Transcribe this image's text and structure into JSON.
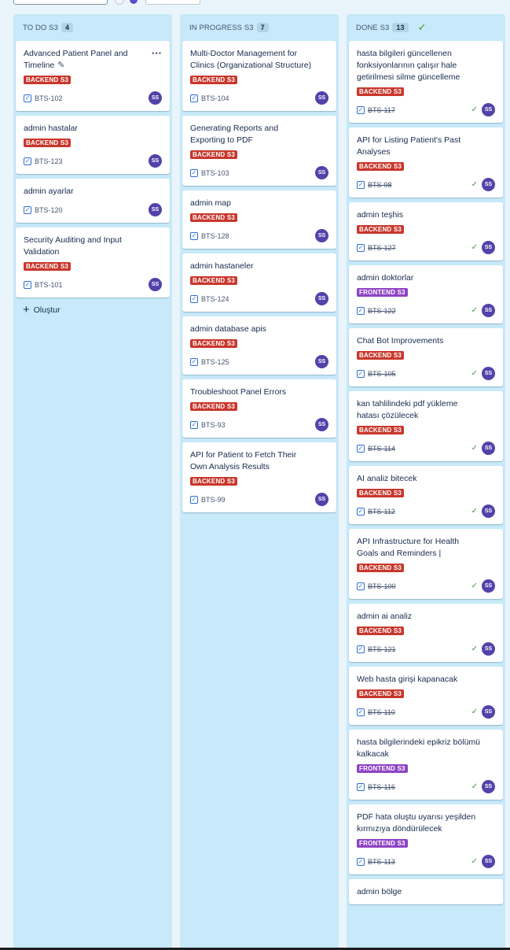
{
  "columns": {
    "todo": {
      "title": "TO DO S3",
      "count": "4",
      "create_label": "Oluştur",
      "cards": [
        {
          "title": "Advanced Patient Panel and Timeline",
          "label": "BACKEND S3",
          "key": "BTS-102",
          "assignee": "SS"
        },
        {
          "title": "admin hastalar",
          "label": "BACKEND S3",
          "key": "BTS-123",
          "assignee": "SS"
        },
        {
          "title": "admin ayarlar",
          "key": "BTS-120",
          "assignee": "SS"
        },
        {
          "title": "Security Auditing and Input Validation",
          "label": "BACKEND S3",
          "key": "BTS-101",
          "assignee": "SS"
        }
      ]
    },
    "in_progress": {
      "title": "IN PROGRESS S3",
      "count": "7",
      "cards": [
        {
          "title": "Multi-Doctor Management for Clinics (Organizational Structure)",
          "label": "BACKEND S3",
          "key": "BTS-104",
          "assignee": "SS"
        },
        {
          "title": "Generating Reports and Exporting to PDF",
          "label": "BACKEND S3",
          "key": "BTS-103",
          "assignee": "SS"
        },
        {
          "title": "admin map",
          "label": "BACKEND S3",
          "key": "BTS-128",
          "assignee": "SS"
        },
        {
          "title": "admin hastaneler",
          "label": "BACKEND S3",
          "key": "BTS-124",
          "assignee": "SS"
        },
        {
          "title": "admin database apis",
          "label": "BACKEND S3",
          "key": "BTS-125",
          "assignee": "SS"
        },
        {
          "title": "Troubleshoot Panel Errors",
          "label": "BACKEND S3",
          "key": "BTS-93",
          "assignee": "SS"
        },
        {
          "title": "API for Patient to Fetch Their Own Analysis Results",
          "label": "BACKEND S3",
          "key": "BTS-99",
          "assignee": "SS"
        }
      ]
    },
    "done": {
      "title": "DONE S3",
      "count": "13",
      "cards": [
        {
          "title": "hasta bilgileri güncellenen fonksiyonlarının çalışır hale getirilmesi silme güncelleme",
          "label": "BACKEND S3",
          "key": "BTS-117",
          "assignee": "SS"
        },
        {
          "title": "API for Listing Patient's Past Analyses",
          "label": "BACKEND S3",
          "key": "BTS-98",
          "assignee": "SS"
        },
        {
          "title": "admin teşhis",
          "label": "BACKEND S3",
          "key": "BTS-127",
          "assignee": "SS"
        },
        {
          "title": "admin doktorlar",
          "label": "FRONTEND S3",
          "key": "BTS-122",
          "assignee": "SS"
        },
        {
          "title": "Chat Bot Improvements",
          "label": "BACKEND S3",
          "key": "BTS-105",
          "assignee": "SS"
        },
        {
          "title": "kan tahlilindeki pdf yükleme hatası çözülecek",
          "label": "BACKEND S3",
          "key": "BTS-114",
          "assignee": "SS"
        },
        {
          "title": "AI analiz bitecek",
          "label": "BACKEND S3",
          "key": "BTS-112",
          "assignee": "SS"
        },
        {
          "title": "API Infrastructure for Health Goals and Reminders |",
          "label": "BACKEND S3",
          "key": "BTS-100",
          "assignee": "SS"
        },
        {
          "title": "admin ai analiz",
          "label": "BACKEND S3",
          "key": "BTS-121",
          "assignee": "SS"
        },
        {
          "title": "Web hasta girişi kapanacak",
          "label": "BACKEND S3",
          "key": "BTS-110",
          "assignee": "SS"
        },
        {
          "title": "hasta bilgilerindeki epikriz bölümü kalkacak",
          "label": "FRONTEND S3",
          "key": "BTS-116",
          "assignee": "SS"
        },
        {
          "title": "PDF hata oluştu uyarısı yeşilden kırmızıya döndürülecek",
          "label": "FRONTEND S3",
          "key": "BTS-113",
          "assignee": "SS"
        },
        {
          "title": "admin bölge"
        }
      ]
    }
  },
  "colors": {
    "backend_label": "#c9372c",
    "frontend_label": "#8f43c4",
    "column_bg": "#c7e9f9",
    "avatar": "#5243aa"
  },
  "icons": [
    "more-icon",
    "edit-icon",
    "task-checkbox-icon",
    "done-check-icon",
    "plus-icon"
  ]
}
